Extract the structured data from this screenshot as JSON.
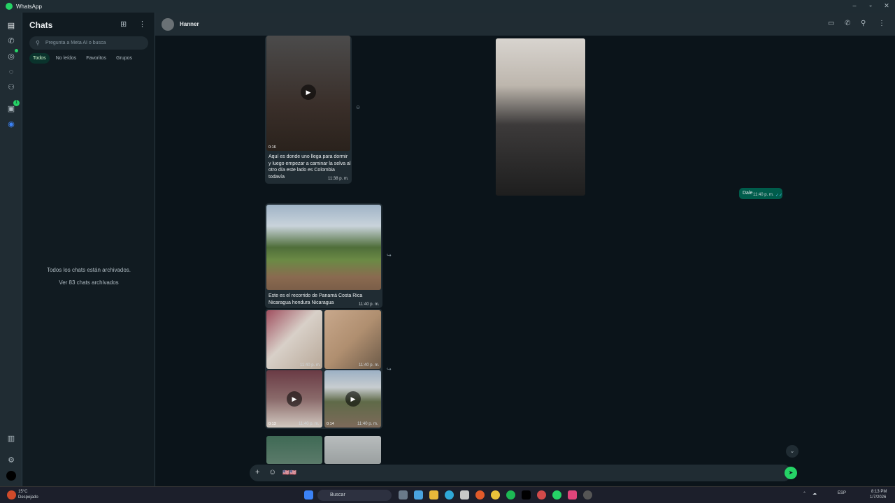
{
  "app": {
    "title": "WhatsApp"
  },
  "window_controls": {
    "minimize": "–",
    "maximize": "▫",
    "close": "✕"
  },
  "sidebar": {
    "title": "Chats",
    "search_placeholder": "Pregunta a Meta AI o busca",
    "filters": [
      "Todos",
      "No leídos",
      "Favoritos",
      "Grupos"
    ],
    "archived_text": "Todos los chats están archivados.",
    "archived_link": "Ver 83 chats archivados"
  },
  "rail": {
    "updates_badge": "1"
  },
  "chat": {
    "contact_name": "Hanner",
    "messages": {
      "video1": {
        "duration": "0:16",
        "caption": "Aquí es donde uno llega para dormir y luego empezar a caminar la selva al otro día este lado es Colombia todavía",
        "time": "11:38 p. m."
      },
      "photo_out": {},
      "dale": {
        "text": "Dale",
        "time": "11:40 p. m."
      },
      "photo_road": {
        "caption": "Este es el recorrido de Panamá Costa Rica Nicaragua hondura Nicaragua",
        "time": "11:40 p. m."
      },
      "grid": [
        {
          "time": "11:40 p. m.",
          "duration": ""
        },
        {
          "time": "11:40 p. m.",
          "duration": ""
        },
        {
          "time": "11:40 p. m.",
          "duration": "0:13"
        },
        {
          "time": "11:40 p. m.",
          "duration": "0:14"
        }
      ]
    },
    "composer_text": "🇺🇸🇺🇸"
  },
  "taskbar": {
    "weather_temp": "15°C",
    "weather_desc": "Despejado",
    "search_label": "Buscar",
    "lang": "ESP",
    "clock_time": "8:13 PM",
    "clock_date": "1/7/2026"
  },
  "colors": {
    "accent": "#25d366",
    "outgoing": "#005c4b",
    "incoming": "#202c33"
  }
}
